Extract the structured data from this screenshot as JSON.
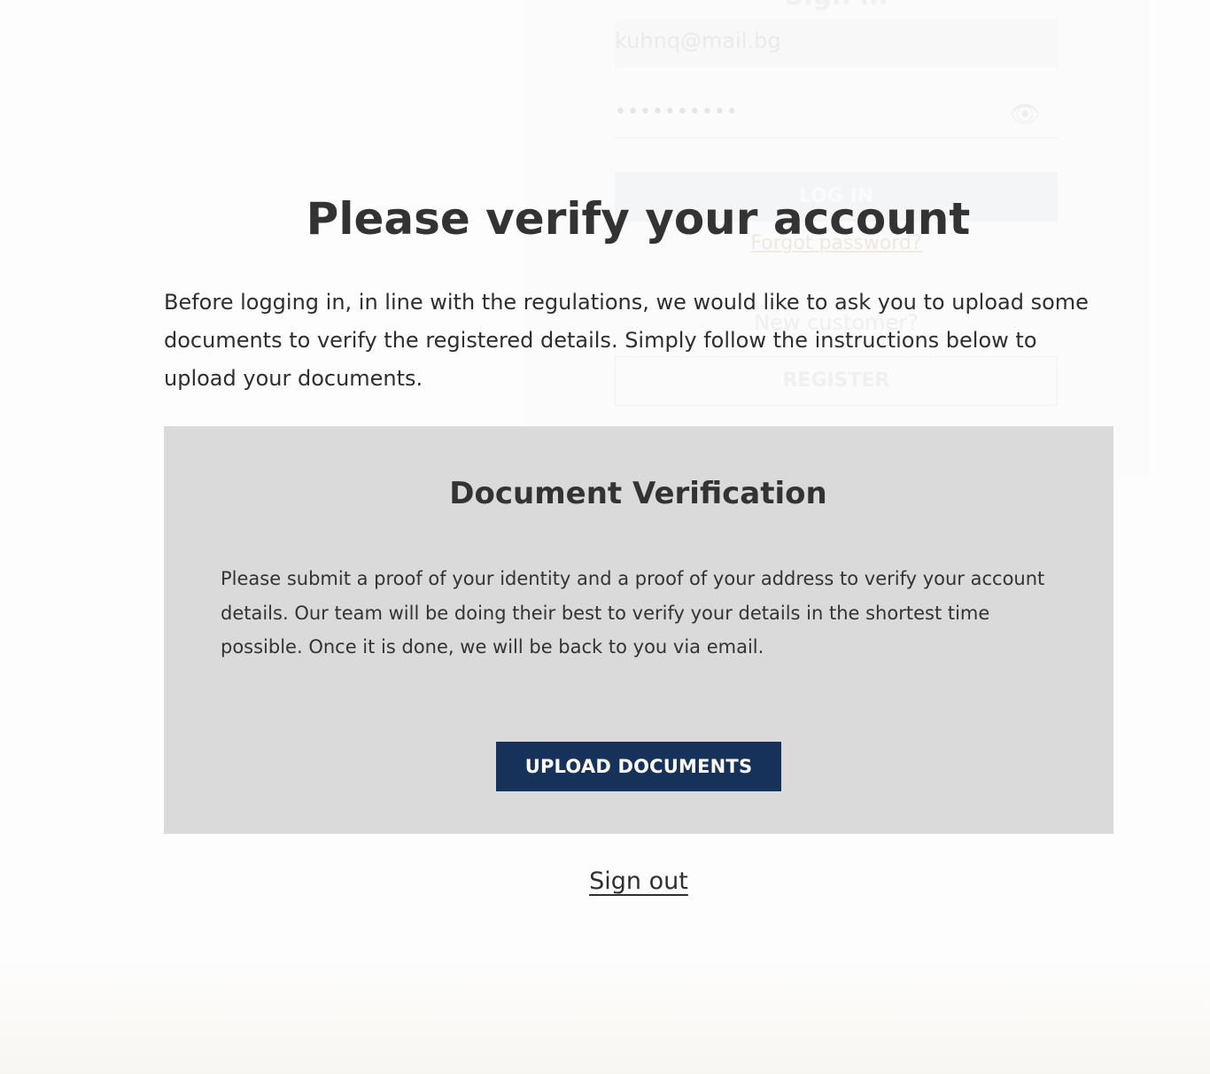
{
  "background_login": {
    "title": "Sign in",
    "email_value": "kuhnq@mail.bg",
    "password_mask": "••••••••••",
    "login_label": "LOG IN",
    "forgot_label": "Forgot password?",
    "new_customer_label": "New customer?",
    "register_label": "REGISTER"
  },
  "verify": {
    "title": "Please verify your account",
    "intro": "Before logging in, in line with the regulations, we would like to ask you to upload some documents to verify the registered details. Simply follow the instructions below to upload your documents."
  },
  "document_verification": {
    "title": "Document Verification",
    "description": "Please submit a proof of your identity and a proof of your address to verify your account details. Our team will be doing their best to verify your details in the shortest time possible. Once it is done, we will be back to you via email.",
    "upload_label": "UPLOAD DOCUMENTS"
  },
  "sign_out_label": "Sign out",
  "colors": {
    "button_bg": "#17325a",
    "panel_bg": "#dadada",
    "text": "#333333"
  }
}
